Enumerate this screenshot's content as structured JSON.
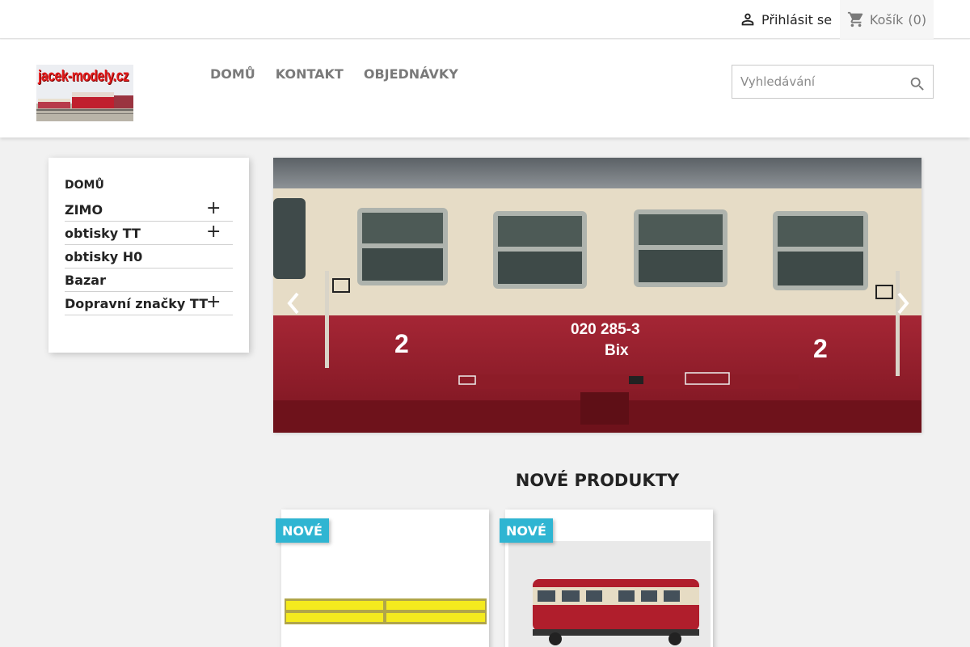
{
  "topbar": {
    "signin_label": "Přihlásit se",
    "cart_label": "Košík",
    "cart_count": "(0)"
  },
  "header": {
    "logo_text": "jacek-modely.cz",
    "nav": [
      {
        "label": "DOMŮ"
      },
      {
        "label": "KONTAKT"
      },
      {
        "label": "OBJEDNÁVKY"
      }
    ],
    "search_placeholder": "Vyhledávání"
  },
  "sidebar": {
    "title": "DOMŮ",
    "items": [
      {
        "label": "ZIMO",
        "expandable": true
      },
      {
        "label": "obtisky TT",
        "expandable": true
      },
      {
        "label": "obtisky H0",
        "expandable": false
      },
      {
        "label": "Bazar",
        "expandable": false
      },
      {
        "label": "Dopravní značky TT",
        "expandable": true
      }
    ]
  },
  "carousel": {
    "car_number": "020 285-3",
    "car_type": "Bix",
    "class_mark": "2"
  },
  "products": {
    "title": "NOVÉ PRODUKTY",
    "badge": "NOVÉ"
  },
  "colors": {
    "accent": "#2fb5d2",
    "car_red": "#8c1a26",
    "car_cream": "#e8dcc4"
  }
}
